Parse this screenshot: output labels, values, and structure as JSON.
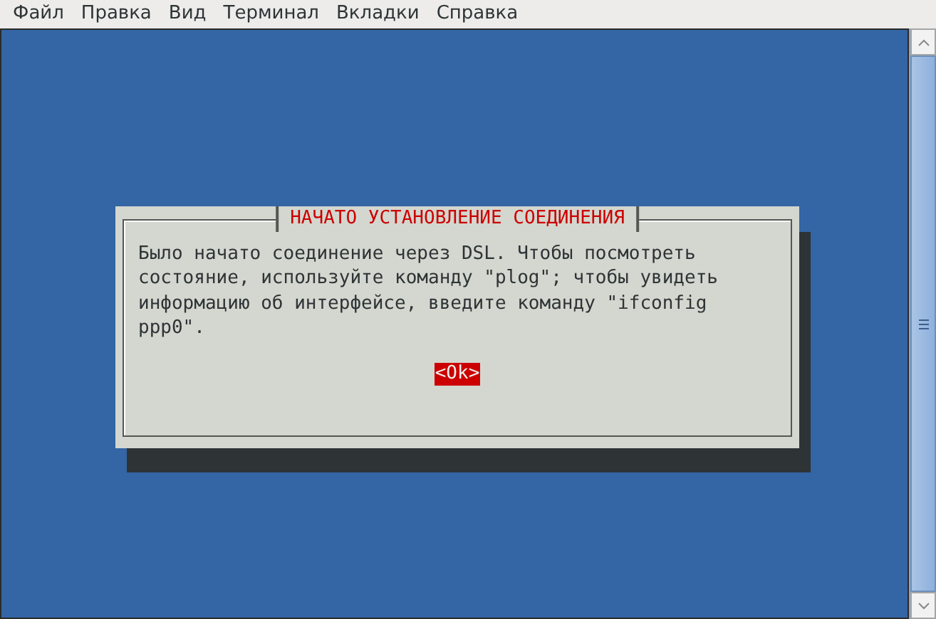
{
  "menu_bar": [
    {
      "label": "Файл"
    },
    {
      "label": "Правка"
    },
    {
      "label": "Вид"
    },
    {
      "label": "Терминал"
    },
    {
      "label": "Вкладки"
    },
    {
      "label": "Справка"
    }
  ],
  "dialog": {
    "title": "НАЧАТО УСТАНОВЛЕНИЕ СОЕДИНЕНИЯ",
    "message": "Было начато соединение через DSL. Чтобы посмотреть\nсостояние, используйте команду \"plog\"; чтобы увидеть\nинформацию об интерфейсе, введите команду \"ifconfig\nppp0\".",
    "buttons": [
      {
        "label": "<Ok>",
        "selected": true
      }
    ]
  }
}
